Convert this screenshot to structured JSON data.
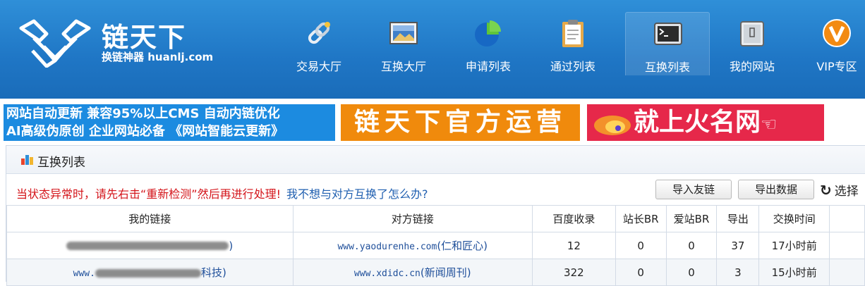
{
  "logo": {
    "title": "链天下",
    "subtitle": "换链神器 huanlj.com"
  },
  "nav": [
    {
      "label": "交易大厅",
      "icon": "chain-link-icon"
    },
    {
      "label": "互换大厅",
      "icon": "landscape-picture-icon"
    },
    {
      "label": "申请列表",
      "icon": "pie-chart-icon"
    },
    {
      "label": "通过列表",
      "icon": "clipboard-icon"
    },
    {
      "label": "互换列表",
      "icon": "terminal-window-icon",
      "active": true
    },
    {
      "label": "我的网站",
      "icon": "tablet-icon"
    },
    {
      "label": "VIP专区",
      "icon": "vip-badge-icon"
    }
  ],
  "banners": {
    "cms_line1": "网站自动更新  兼容95%以上CMS  自动内链优化",
    "cms_line2": "AI高级伪原创  企业网站必备 《网站智能云更新》",
    "official": "链天下官方运营",
    "huoming": "就上火名网"
  },
  "panel": {
    "title": "互换列表",
    "notice": "当状态异常时，请先右击“重新检测”然后再进行处理!",
    "help_link": "我不想与对方互换了怎么办?",
    "import_button": "导入友链",
    "export_button": "导出数据",
    "select_label": "选择"
  },
  "table": {
    "headers": [
      "我的链接",
      "对方链接",
      "百度收录",
      "站长BR",
      "爱站BR",
      "导出",
      "交换时间"
    ],
    "rows": [
      {
        "my_link_prefix": "",
        "my_link_suffix": ")",
        "their_domain": "www.yaodurenhe.com",
        "their_name": "(仁和匠心)",
        "baidu": "12",
        "zz_br": "0",
        "az_br": "0",
        "export": "37",
        "time": "17小时前"
      },
      {
        "my_link_prefix": "www.",
        "my_link_suffix": "科技)",
        "their_domain": "www.xdidc.cn",
        "their_name": "(新闻周刊)",
        "baidu": "322",
        "zz_br": "0",
        "az_br": "0",
        "export": "3",
        "time": "15小时前"
      }
    ]
  },
  "colors": {
    "header": "#1f76c5",
    "warn": "#d4141a",
    "link": "#1f4f9a",
    "banner_blue": "#1c8be0",
    "banner_orange": "#f08a0c",
    "banner_red": "#e6284a"
  }
}
